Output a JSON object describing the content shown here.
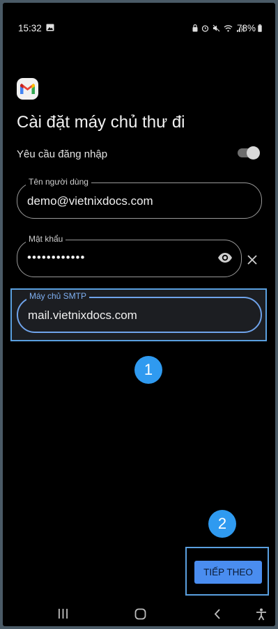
{
  "status_bar": {
    "time": "15:32",
    "battery": "78%"
  },
  "page": {
    "title": "Cài đặt máy chủ thư đi",
    "login_required_label": "Yêu cầu đăng nhập",
    "login_required_on": true
  },
  "fields": {
    "username": {
      "label": "Tên người dùng",
      "value": "demo@vietnixdocs.com"
    },
    "password": {
      "label": "Mật khẩu",
      "value": "••••••••••••"
    },
    "smtp": {
      "label": "Máy chủ SMTP",
      "value": "mail.vietnixdocs.com"
    }
  },
  "annotations": {
    "step1": "1",
    "step2": "2"
  },
  "buttons": {
    "next": "TIẾP THEO"
  },
  "colors": {
    "accent": "#4a8df0",
    "annotation": "#2f9af0",
    "background": "#000000"
  },
  "icons": [
    "gmail-logo",
    "eye-icon",
    "close-icon",
    "recent-apps-icon",
    "home-icon",
    "back-icon",
    "accessibility-icon"
  ]
}
